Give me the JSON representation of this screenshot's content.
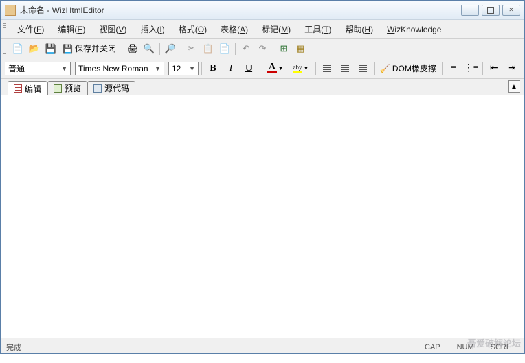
{
  "window": {
    "title": "未命名 - WizHtmlEditor"
  },
  "menu": {
    "file": "文件(F)",
    "edit": "编辑(E)",
    "view": "视图(V)",
    "insert": "插入(I)",
    "format": "格式(O)",
    "table": "表格(A)",
    "mark": "标记(M)",
    "tools": "工具(T)",
    "help": "帮助(H)",
    "wiz": "WizKnowledge"
  },
  "toolbar": {
    "saveclose": "保存并关闭"
  },
  "format": {
    "style": "普通",
    "font": "Times New Roman",
    "size": "12",
    "bold": "B",
    "italic": "I",
    "underline": "U",
    "fontcolor": "A",
    "highlight": "aby",
    "eraser": "DOM橡皮擦"
  },
  "tabs": {
    "edit": "编辑",
    "preview": "预览",
    "source": "源代码"
  },
  "status": {
    "done": "完成",
    "cap": "CAP",
    "num": "NUM",
    "scrl": "SCRL"
  },
  "watermark": "吾爱破解论坛"
}
